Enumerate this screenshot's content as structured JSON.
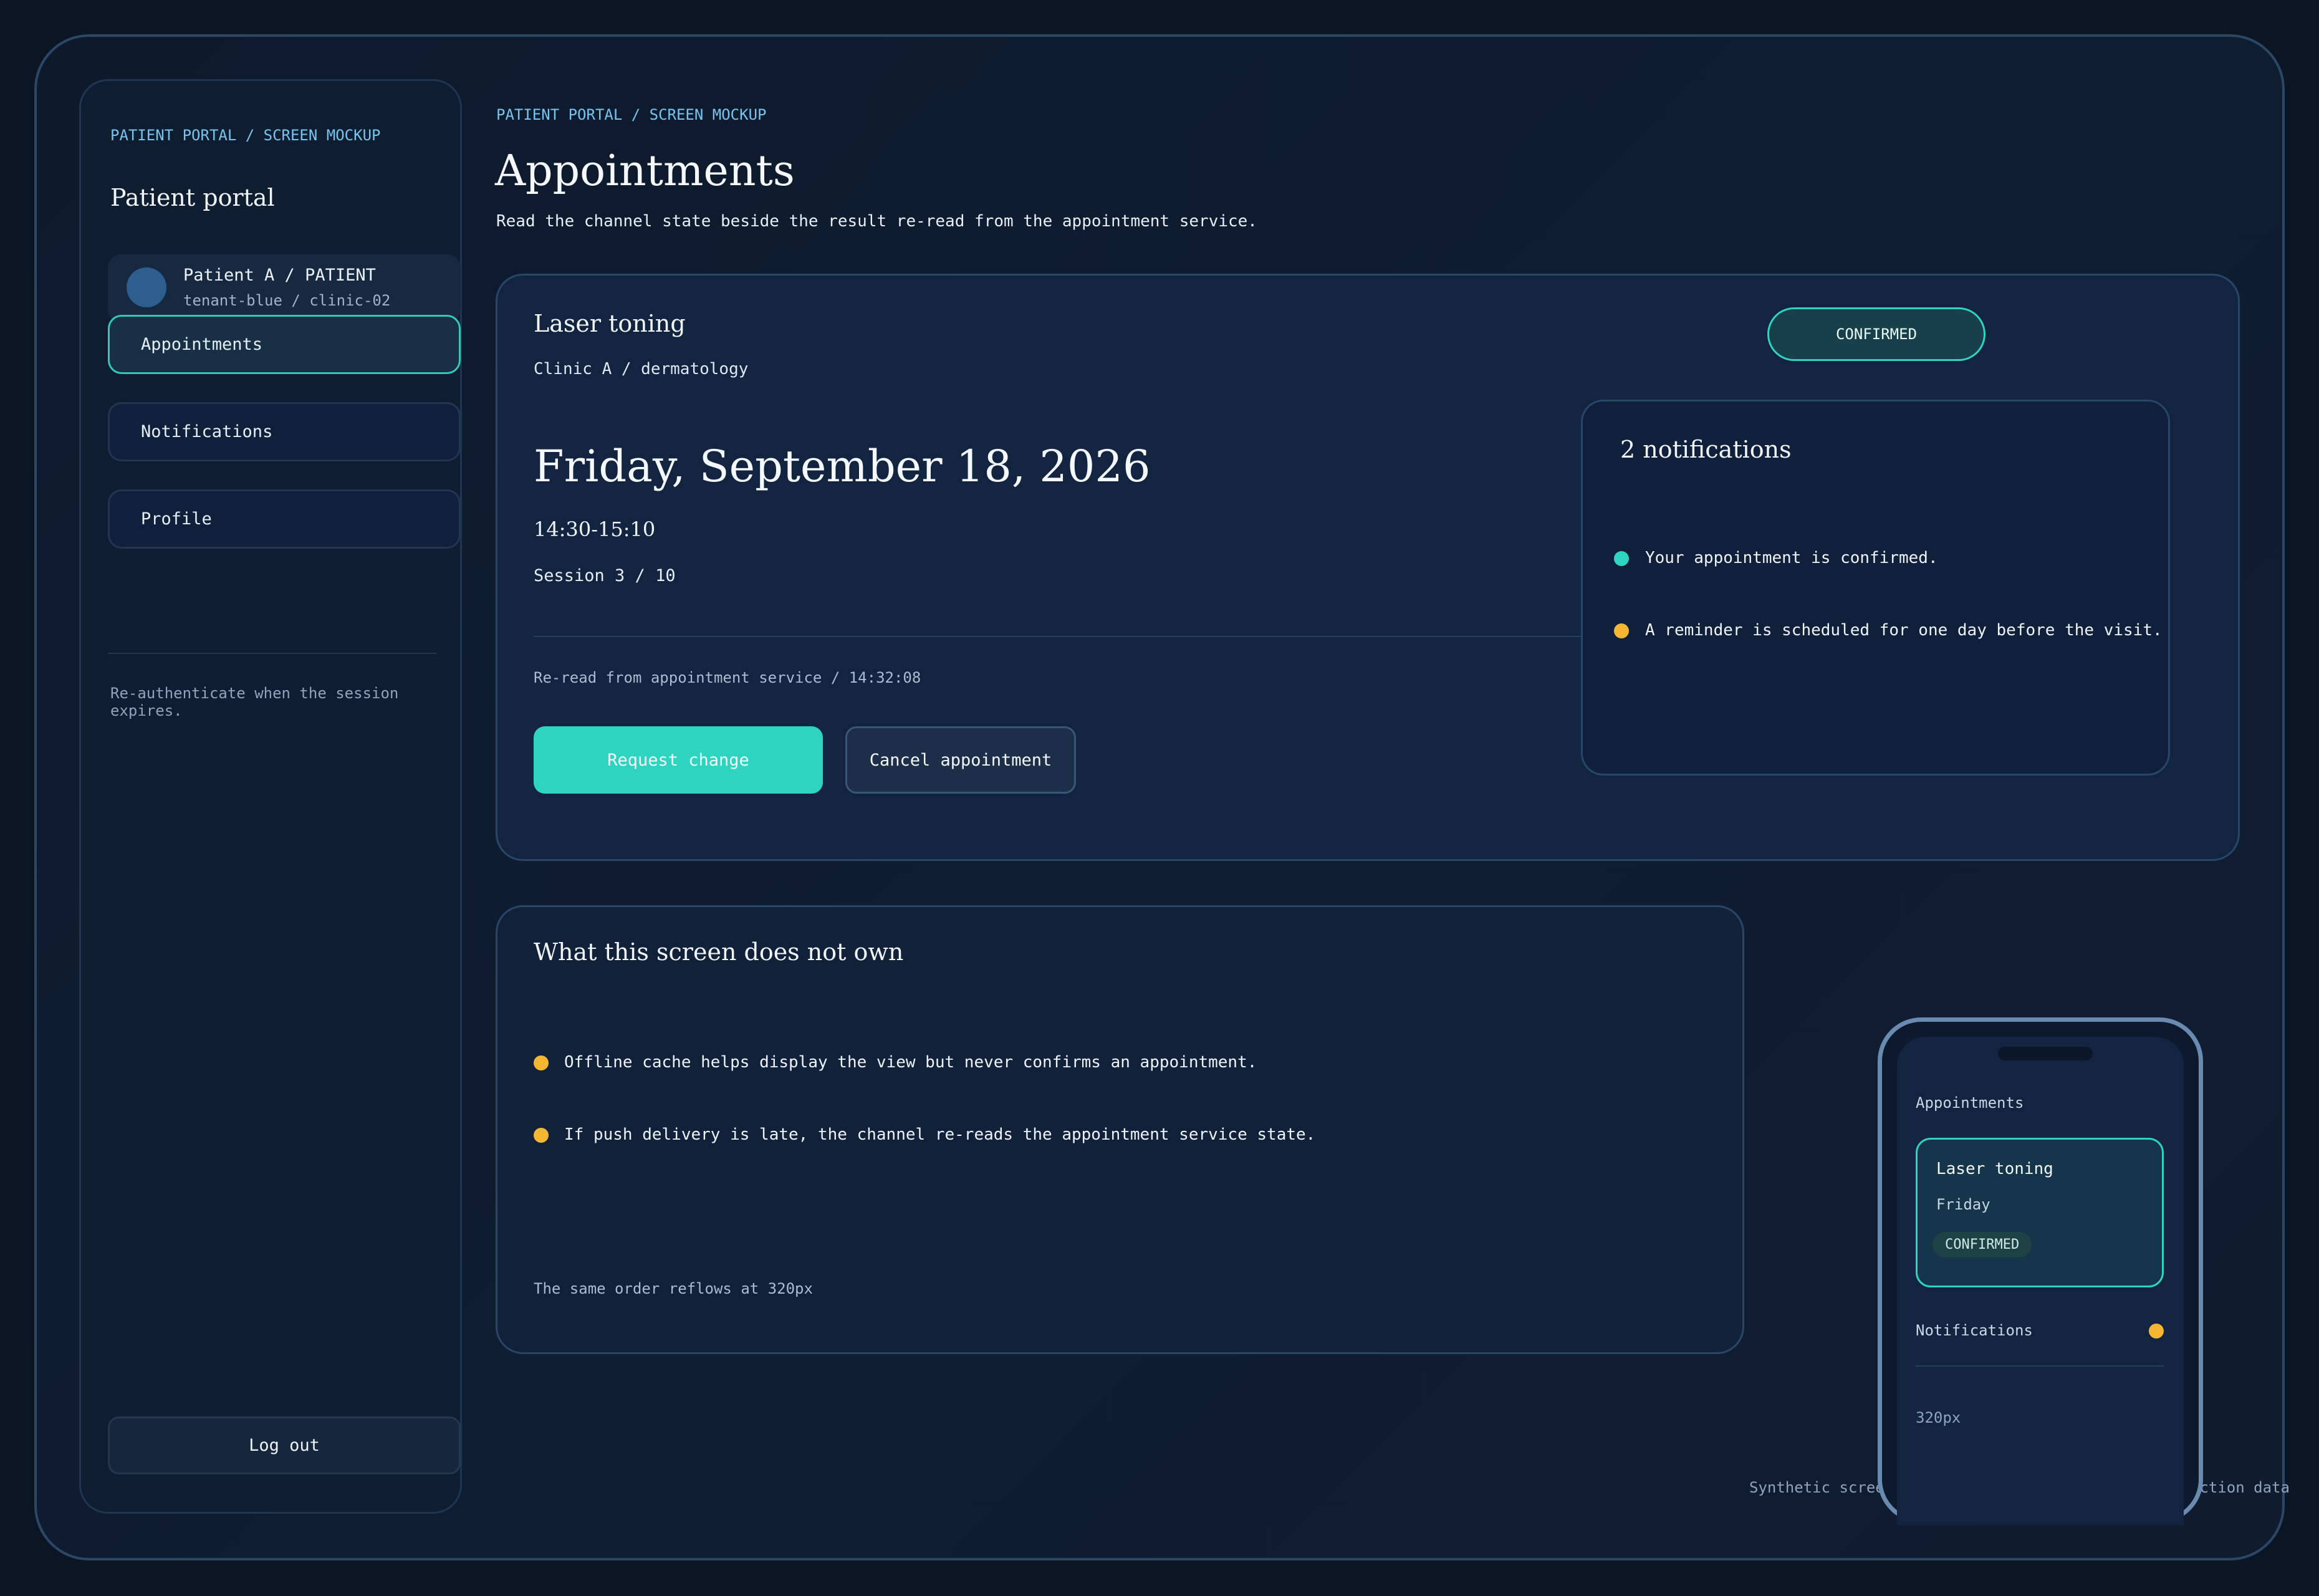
{
  "sidebar": {
    "breadcrumb": "PATIENT PORTAL / SCREEN MOCKUP",
    "title": "Patient portal",
    "user": {
      "name": "Patient A / PATIENT",
      "tenant": "tenant-blue / clinic-02"
    },
    "nav": [
      {
        "label": "Appointments"
      },
      {
        "label": "Notifications"
      },
      {
        "label": "Profile"
      }
    ],
    "session_note": "Re-authenticate when the session expires.",
    "logout_label": "Log out"
  },
  "header": {
    "breadcrumb": "PATIENT PORTAL / SCREEN MOCKUP",
    "title": "Appointments",
    "subtitle": "Read the channel state beside the result re-read from the appointment service."
  },
  "appointment": {
    "treatment": "Laser toning",
    "clinic": "Clinic A / dermatology",
    "status": "CONFIRMED",
    "date": "Friday, September 18, 2026",
    "time": "14:30-15:10",
    "session": "Session 3 / 10",
    "reread": "Re-read from appointment service / 14:32:08",
    "request_change_label": "Request change",
    "cancel_label": "Cancel appointment",
    "status_color": "#2fd4c1"
  },
  "notifications": {
    "title": "2 notifications",
    "items": [
      {
        "text": "Your appointment is confirmed.",
        "color": "#2fd4c1"
      },
      {
        "text": "A reminder is scheduled for one day before the visit.",
        "color": "#f5b731"
      }
    ]
  },
  "ownership": {
    "title": "What this screen does not own",
    "items": [
      {
        "text": "Offline cache helps display the view but never confirms an appointment.",
        "color": "#f5b731"
      },
      {
        "text": "If push delivery is late, the channel re-reads the appointment service state.",
        "color": "#f5b731"
      }
    ],
    "footnote": "The same order reflows at 320px"
  },
  "phone": {
    "section": "Appointments",
    "treatment": "Laser toning",
    "day": "Friday",
    "status": "CONFIRMED",
    "notifications_label": "Notifications",
    "width_label": "320px"
  },
  "footer": "Synthetic screen mockup / no real patient or production data"
}
